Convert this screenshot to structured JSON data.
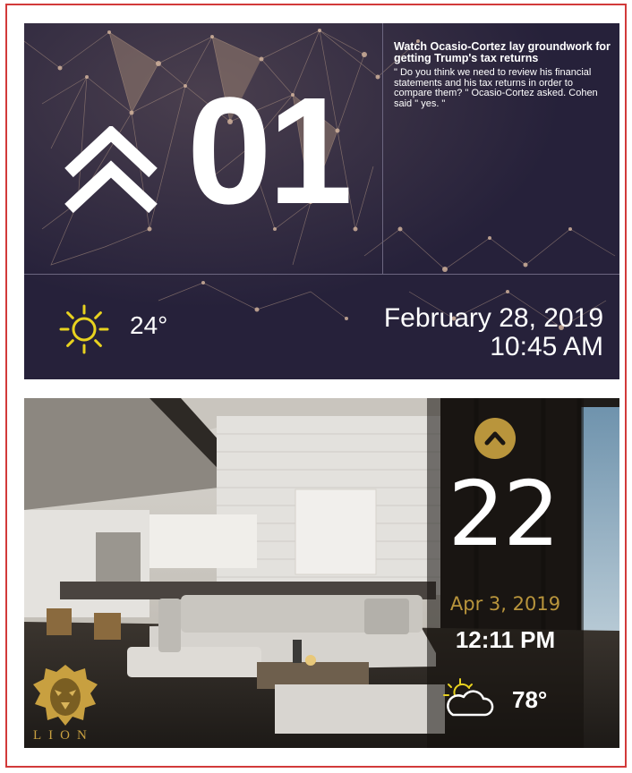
{
  "panel1": {
    "rank_number": "01",
    "news_headline": "Watch Ocasio-Cortez lay groundwork for getting Trump's tax returns",
    "news_body": "\" Do you think we need to review his financial statements and his tax returns in order to compare them? \" Ocasio-Cortez asked. Cohen said \" yes. \"",
    "temperature": "24°",
    "date": "February 28, 2019",
    "time": "10:45 AM",
    "icons": [
      "double-chevron-up-icon",
      "sun-icon"
    ],
    "colors": {
      "background": "#26213a",
      "sun": "#e8d21f",
      "text": "#ffffff"
    }
  },
  "panel2": {
    "floor_number": "22",
    "date": "Apr 3, 2019",
    "time": "12:11 PM",
    "temperature": "78°",
    "logo_text": "LION",
    "icons": [
      "chevron-up-icon",
      "partly-cloudy-icon",
      "lion-logo"
    ],
    "colors": {
      "accent": "#b9953c",
      "text": "#ffffff"
    }
  }
}
